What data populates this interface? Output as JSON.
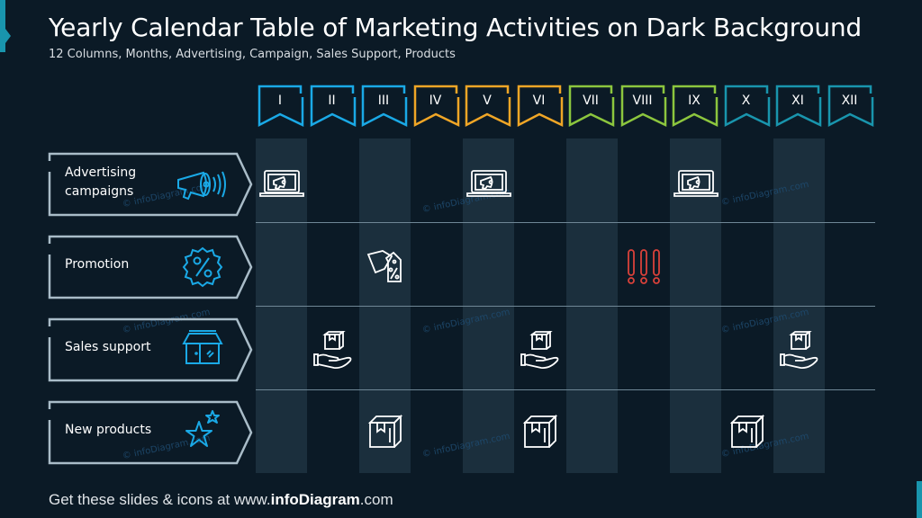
{
  "header": {
    "title": "Yearly Calendar Table of Marketing Activities on Dark Background",
    "subtitle": "12 Columns, Months, Advertising, Campaign, Sales Support, Products"
  },
  "colors": {
    "background": "#0b1a26",
    "band": "#1b2f3d",
    "q1": "#1aa9e6",
    "q2": "#f0a626",
    "q3": "#8cc63e",
    "q4": "#1995ad",
    "category_icon": "#1aa9e6",
    "alert": "#d9413a",
    "accent": "#1995ad"
  },
  "months": [
    {
      "label": "I",
      "quarter": "q1"
    },
    {
      "label": "II",
      "quarter": "q1"
    },
    {
      "label": "III",
      "quarter": "q1"
    },
    {
      "label": "IV",
      "quarter": "q2"
    },
    {
      "label": "V",
      "quarter": "q2"
    },
    {
      "label": "VI",
      "quarter": "q2"
    },
    {
      "label": "VII",
      "quarter": "q3"
    },
    {
      "label": "VIII",
      "quarter": "q3"
    },
    {
      "label": "IX",
      "quarter": "q3"
    },
    {
      "label": "X",
      "quarter": "q4"
    },
    {
      "label": "XI",
      "quarter": "q4"
    },
    {
      "label": "XII",
      "quarter": "q4"
    }
  ],
  "rows": [
    {
      "label_line1": "Advertising",
      "label_line2": "campaigns",
      "icon": "megaphone-icon",
      "activities": [
        {
          "month": "I",
          "icon": "laptop-megaphone-icon"
        },
        {
          "month": "V",
          "icon": "laptop-megaphone-icon"
        },
        {
          "month": "IX",
          "icon": "laptop-megaphone-icon"
        }
      ]
    },
    {
      "label_line1": "Promotion",
      "label_line2": "",
      "icon": "percent-badge-icon",
      "activities": [
        {
          "month": "III",
          "icon": "price-tags-icon"
        },
        {
          "month": "VIII",
          "icon": "exclamation-marks-icon"
        }
      ]
    },
    {
      "label_line1": "Sales support",
      "label_line2": "",
      "icon": "store-icon",
      "activities": [
        {
          "month": "II",
          "icon": "hand-box-icon"
        },
        {
          "month": "VI",
          "icon": "hand-box-icon"
        },
        {
          "month": "XI",
          "icon": "hand-box-icon"
        }
      ]
    },
    {
      "label_line1": "New products",
      "label_line2": "",
      "icon": "stars-icon",
      "activities": [
        {
          "month": "III",
          "icon": "box-icon"
        },
        {
          "month": "VI",
          "icon": "box-icon"
        },
        {
          "month": "X",
          "icon": "box-icon"
        }
      ]
    }
  ],
  "watermark": "© infoDiagram.com",
  "footer": {
    "prefix": "Get these slides & icons at www.",
    "brand": "infoDiagram",
    "suffix": ".com"
  }
}
